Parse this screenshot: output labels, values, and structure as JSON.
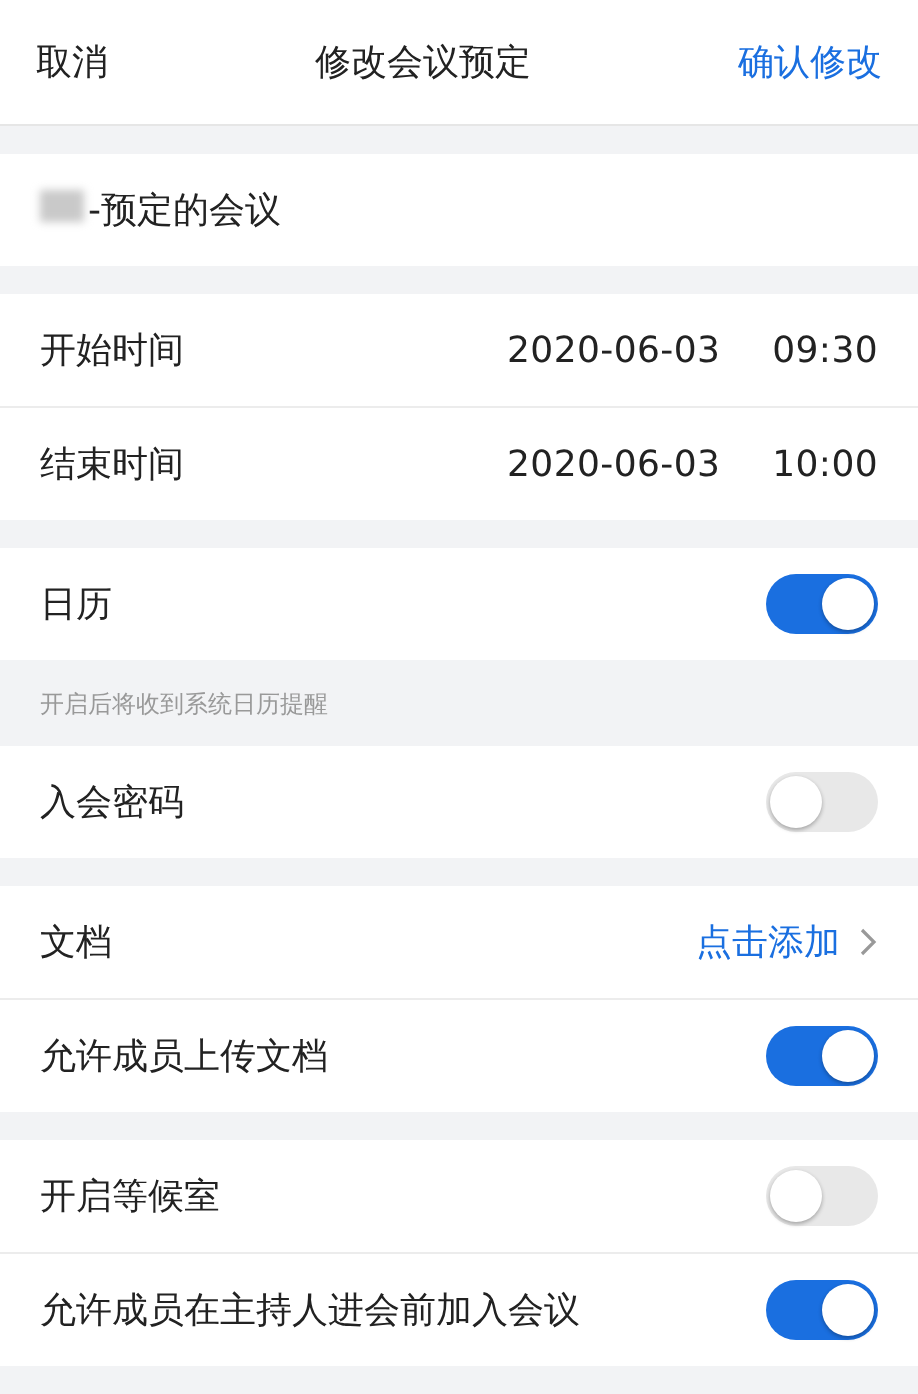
{
  "header": {
    "cancel": "取消",
    "title": "修改会议预定",
    "confirm": "确认修改"
  },
  "sections": [
    {
      "items": [
        {
          "kind": "field",
          "value": "-预定的会议",
          "redacted": true
        }
      ]
    },
    {
      "items": [
        {
          "kind": "datetime",
          "label": "开始时间",
          "date": "2020-06-03",
          "time": "09:30"
        },
        {
          "kind": "datetime",
          "label": "结束时间",
          "date": "2020-06-03",
          "time": "10:00"
        }
      ]
    },
    {
      "items": [
        {
          "kind": "toggle",
          "label": "日历",
          "on": true
        }
      ],
      "note": "开启后将收到系统日历提醒"
    },
    {
      "items": [
        {
          "kind": "toggle",
          "label": "入会密码",
          "on": false
        }
      ]
    },
    {
      "items": [
        {
          "kind": "link",
          "label": "文档",
          "action": "点击添加"
        },
        {
          "kind": "toggle",
          "label": "允许成员上传文档",
          "on": true
        }
      ]
    },
    {
      "items": [
        {
          "kind": "toggle",
          "label": "开启等候室",
          "on": false
        },
        {
          "kind": "toggle",
          "label": "允许成员在主持人进会前加入会议",
          "on": true
        }
      ]
    }
  ]
}
